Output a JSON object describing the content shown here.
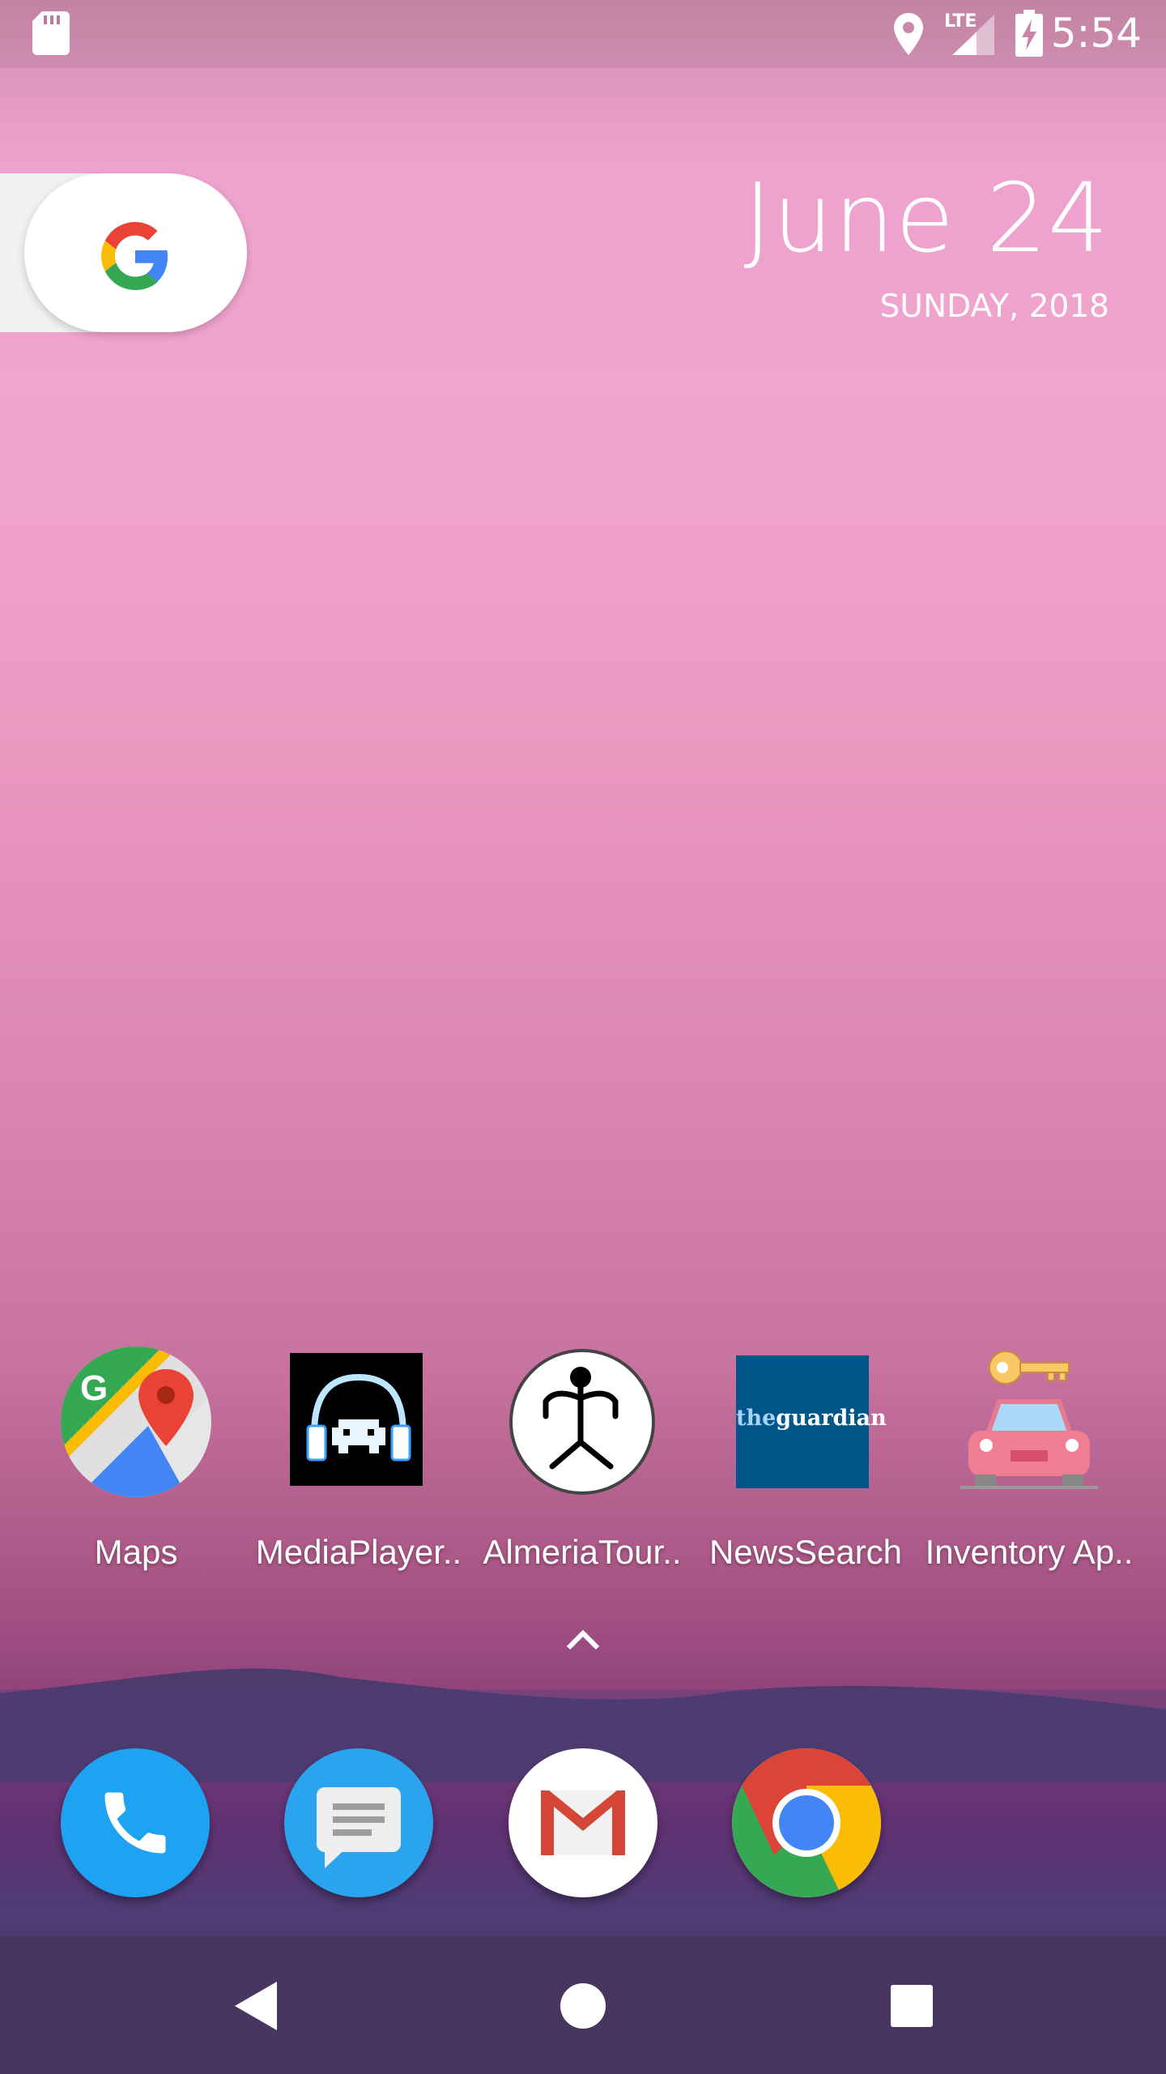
{
  "status_bar": {
    "network_label": "LTE",
    "time": "5:54",
    "icons": [
      "sd-card-icon",
      "location-icon",
      "signal-icon",
      "battery-charging-icon"
    ]
  },
  "search": {
    "logo": "G"
  },
  "date_widget": {
    "date": "June 24",
    "day": "SUNDAY, 2018"
  },
  "apps": [
    {
      "label": "Maps",
      "icon": "maps-icon"
    },
    {
      "label": "MediaPlayer..",
      "icon": "media-player-icon"
    },
    {
      "label": "AlmeriaTour..",
      "icon": "almeria-tour-icon"
    },
    {
      "label": "NewsSearch",
      "icon": "news-search-icon",
      "icon_text_a": "the",
      "icon_text_b": "guardian"
    },
    {
      "label": "Inventory Ap..",
      "icon": "inventory-app-icon"
    }
  ],
  "dock": [
    {
      "name": "Phone",
      "icon": "phone-icon"
    },
    {
      "name": "Messages",
      "icon": "messages-icon"
    },
    {
      "name": "Gmail",
      "icon": "gmail-icon"
    },
    {
      "name": "Chrome",
      "icon": "chrome-icon"
    }
  ],
  "colors": {
    "accent_blue": "#4285F4",
    "accent_red": "#EA4335",
    "accent_yellow": "#FBBC05",
    "accent_green": "#34A853",
    "guardian_blue": "#005689",
    "dock_blue": "#1DA1F2",
    "nav_bar": "#483661"
  },
  "nav": [
    "back-icon",
    "home-icon",
    "recents-icon"
  ]
}
